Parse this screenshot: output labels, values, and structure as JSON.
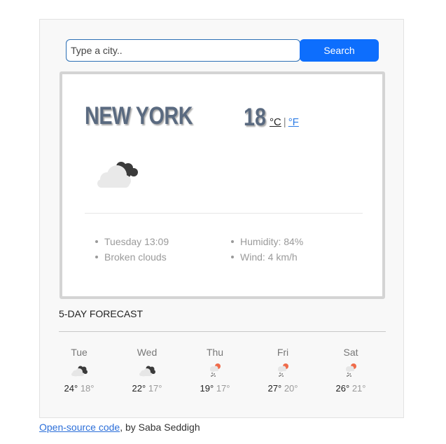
{
  "search": {
    "placeholder": "Type a city..",
    "value": "",
    "button_label": "Search",
    "button_color": "#0d6efd"
  },
  "current": {
    "city": "New York",
    "temperature": "18",
    "unit_celsius": "°C",
    "unit_separator": "|",
    "unit_fahrenheit": "°F",
    "icon": "broken-clouds-icon",
    "details_left": [
      "Tuesday 13:09",
      "Broken clouds"
    ],
    "details_right": [
      "Humidity: 84%",
      "Wind: 4 km/h"
    ]
  },
  "forecast": {
    "title": "5-DAY FORECAST",
    "days": [
      {
        "day": "Tue",
        "icon": "broken-clouds-icon",
        "max": "24°",
        "min": "18°"
      },
      {
        "day": "Wed",
        "icon": "broken-clouds-icon",
        "max": "22°",
        "min": "17°"
      },
      {
        "day": "Thu",
        "icon": "rain-icon",
        "max": "19°",
        "min": "17°"
      },
      {
        "day": "Fri",
        "icon": "rain-icon",
        "max": "27°",
        "min": "20°"
      },
      {
        "day": "Sat",
        "icon": "rain-icon",
        "max": "26°",
        "min": "21°"
      }
    ]
  },
  "footer": {
    "link_text": "Open-source code",
    "suffix": ", by Saba Seddigh"
  }
}
